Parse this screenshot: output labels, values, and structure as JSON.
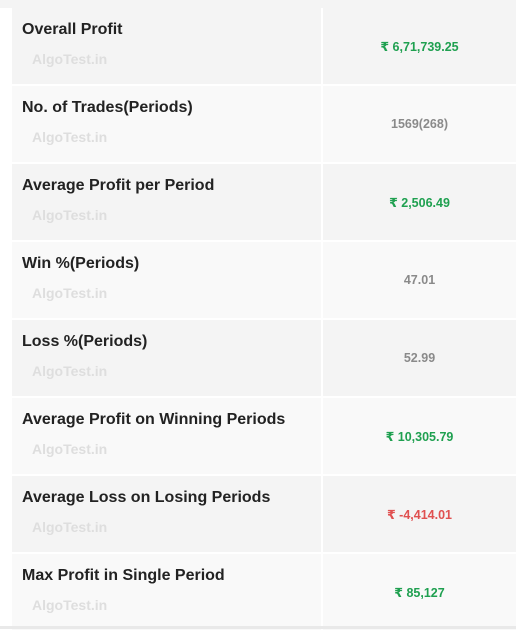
{
  "watermark": "AlgoTest.in",
  "colors": {
    "positive": "#1fa050",
    "neutral": "#8a8a8a",
    "negative": "#e05050"
  },
  "stats": [
    {
      "label": "Overall Profit",
      "value": "₹ 6,71,739.25",
      "tone": "positive"
    },
    {
      "label": "No. of Trades(Periods)",
      "value": "1569(268)",
      "tone": "neutral"
    },
    {
      "label": "Average Profit per Period",
      "value": "₹ 2,506.49",
      "tone": "positive"
    },
    {
      "label": "Win %(Periods)",
      "value": "47.01",
      "tone": "neutral"
    },
    {
      "label": "Loss %(Periods)",
      "value": "52.99",
      "tone": "neutral"
    },
    {
      "label": "Average Profit on Winning Periods",
      "value": "₹ 10,305.79",
      "tone": "positive"
    },
    {
      "label": "Average Loss on Losing Periods",
      "value": "₹ -4,414.01",
      "tone": "negative"
    },
    {
      "label": "Max Profit in Single Period",
      "value": "₹ 85,127",
      "tone": "positive"
    }
  ]
}
